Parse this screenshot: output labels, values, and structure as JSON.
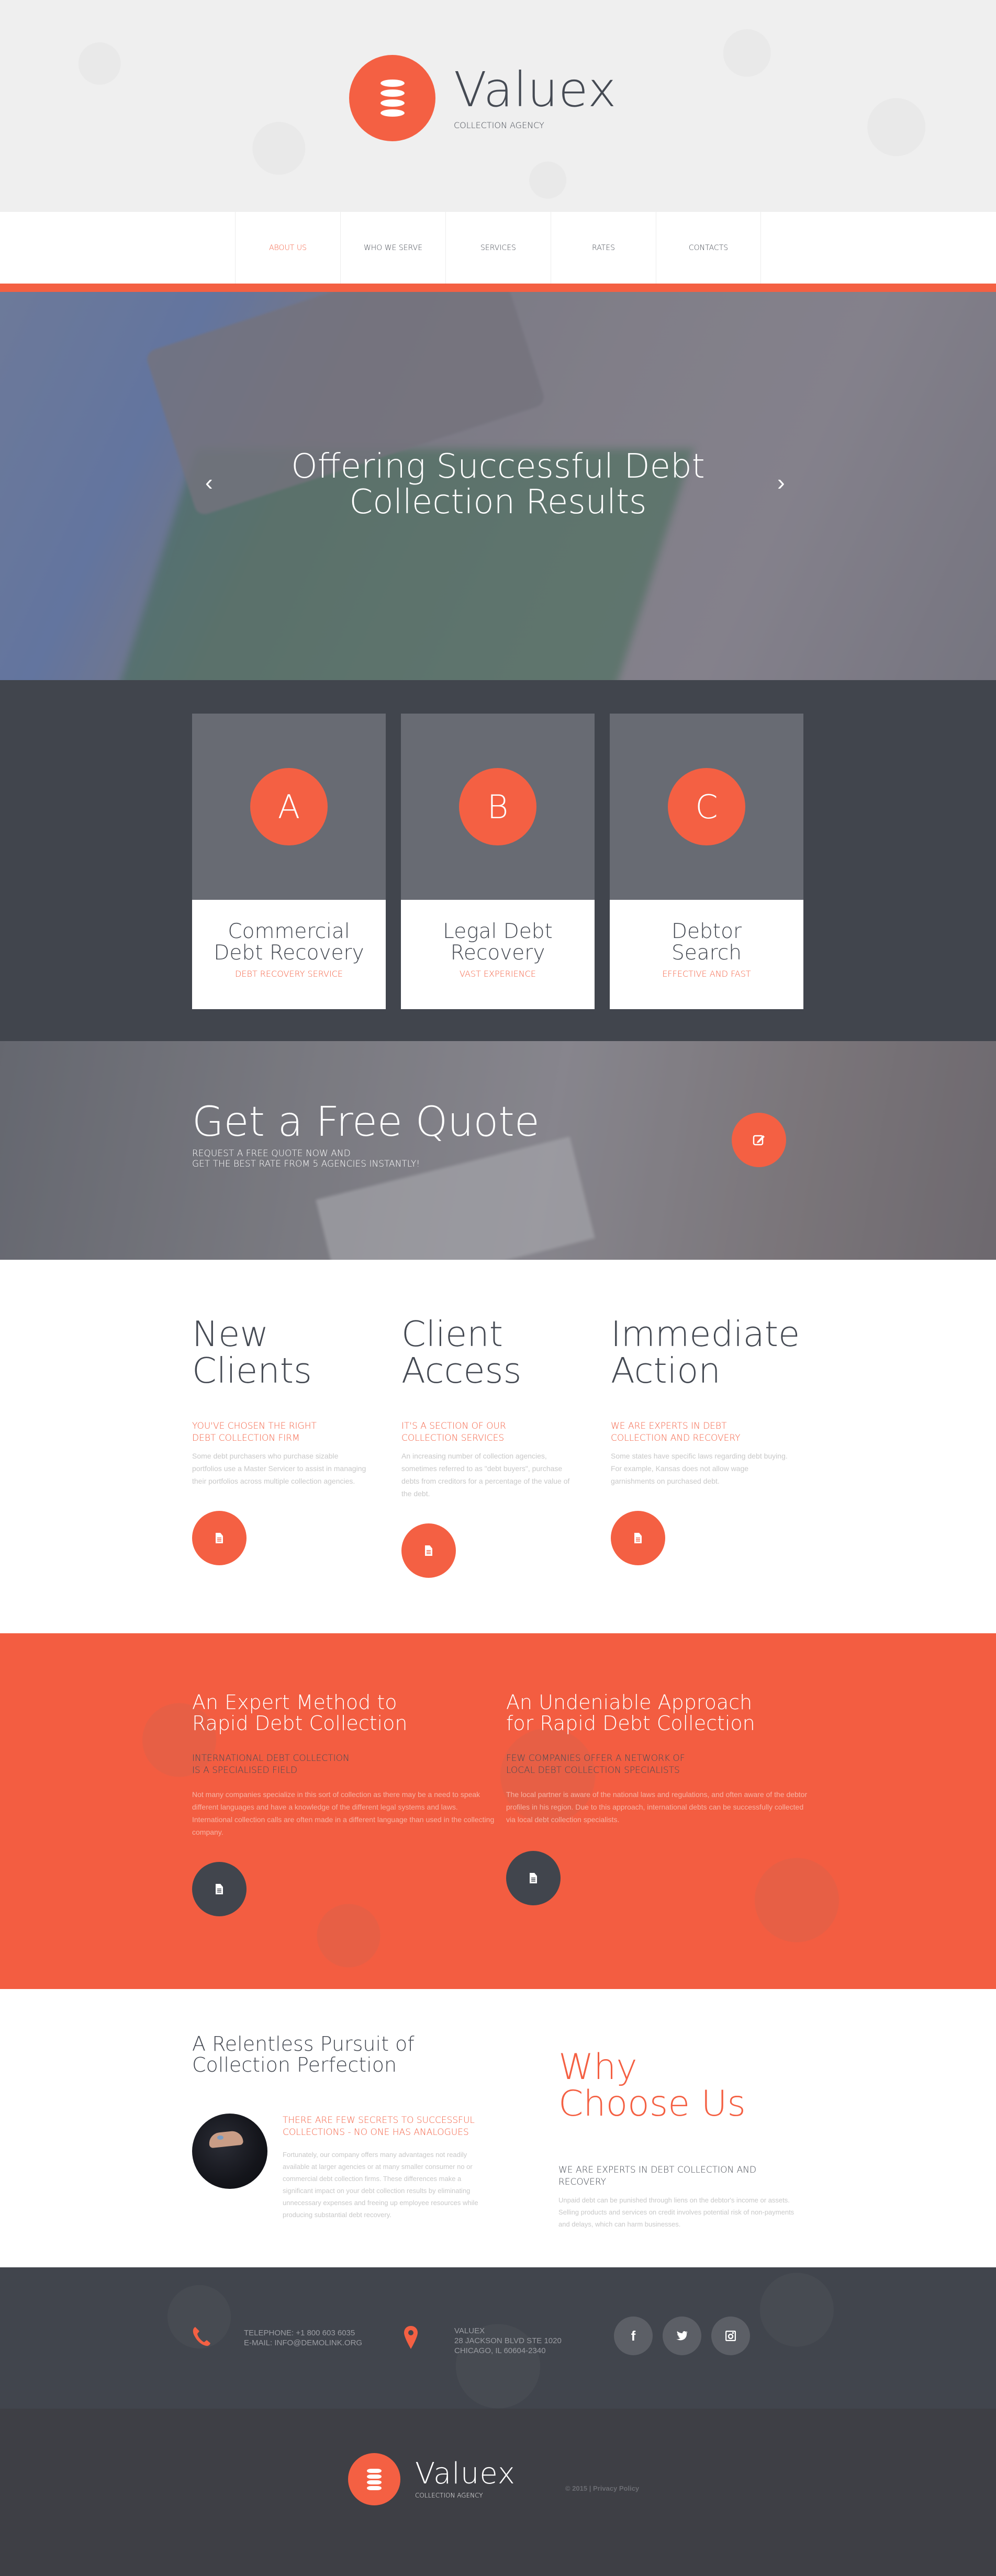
{
  "brand": {
    "name": "Valuex",
    "tagline": "COLLECTION AGENCY",
    "accent": "#f46043",
    "dark": "#41454d"
  },
  "nav": {
    "items": [
      {
        "label": "ABOUT US",
        "active": true
      },
      {
        "label": "WHO WE SERVE"
      },
      {
        "label": "SERVICES"
      },
      {
        "label": "RATES"
      },
      {
        "label": "CONTACTS"
      }
    ]
  },
  "hero": {
    "title_line1": "Offering Successful Debt",
    "title_line2": "Collection Results",
    "prev": "‹",
    "next": "›"
  },
  "services": [
    {
      "letter": "A",
      "title_line1": "Commercial",
      "title_line2": "Debt Recovery",
      "subtitle": "DEBT RECOVERY SERVICE"
    },
    {
      "letter": "B",
      "title_line1": "Legal Debt",
      "title_line2": "Recovery",
      "subtitle": "VAST EXPERIENCE"
    },
    {
      "letter": "C",
      "title_line1": "Debtor",
      "title_line2": "Search",
      "subtitle": "EFFECTIVE AND FAST"
    }
  ],
  "quote": {
    "title": "Get a Free Quote",
    "line1": "REQUEST A FREE QUOTE NOW AND",
    "line2": "GET THE BEST RATE FROM 5 AGENCIES INSTANTLY!"
  },
  "features": [
    {
      "title_line1": "New",
      "title_line2": "Clients",
      "hl_line1": "YOU'VE CHOSEN THE RIGHT",
      "hl_line2": "DEBT COLLECTION FIRM",
      "body": "Some debt purchasers who purchase sizable portfolios use a Master Servicer to assist in managing their portfolios  across multiple collection agencies."
    },
    {
      "title_line1": "Client",
      "title_line2": "Access",
      "hl_line1": "IT'S A SECTION OF OUR",
      "hl_line2": "COLLECTION SERVICES",
      "body": "An increasing number of collection agencies, sometimes referred to as \"debt buyers\", purchase debts from creditors for a percentage of the value of the debt."
    },
    {
      "title_line1": "Immediate",
      "title_line2": "Action",
      "hl_line1": "WE ARE EXPERTS IN DEBT",
      "hl_line2": "COLLECTION AND RECOVERY",
      "body": "Some states have specific laws regarding debt buying. For example, Kansas does not allow wage garnishments on purchased debt."
    }
  ],
  "approaches": [
    {
      "title_line1": "An Expert Method to",
      "title_line2": "Rapid Debt Collection",
      "hl_line1": "INTERNATIONAL DEBT COLLECTION",
      "hl_line2": "IS A SPECIALISED FIELD",
      "body": "Not many companies specialize in this sort of collection as there may be a need to speak different languages and have a knowledge of the different legal systems and laws. International collection calls are often made in a different language than used in the collecting company."
    },
    {
      "title_line1": "An Undeniable Approach",
      "title_line2": "for Rapid Debt Collection",
      "hl_line1": "FEW COMPANIES OFFER A NETWORK OF",
      "hl_line2": "LOCAL DEBT COLLECTION SPECIALISTS",
      "body": "The local partner is aware of the national laws and regulations, and often aware of the debtor profiles in his region. Due to this approach, international debts can be successfully collected via local debt collection specialists."
    }
  ],
  "pursuit": {
    "title_line1": "A Relentless Pursuit of",
    "title_line2": "Collection Perfection",
    "hl_line1": "THERE ARE FEW SECRETS TO SUCCESSFUL",
    "hl_line2": "COLLECTIONS - NO ONE HAS ANALOGUES",
    "body": "Fortunately, our company offers many advantages not readily available at larger agencies or at many smaller consumer no or commercial debt collection firms. These differences make a significant impact on your debt collection results by eliminating unnecessary expenses and freeing up employee resources while producing substantial debt recovery."
  },
  "why": {
    "title_line1": "Why",
    "title_line2": "Choose Us",
    "hl": "WE ARE EXPERTS IN DEBT COLLECTION AND RECOVERY",
    "body": "Unpaid debt can be punished through liens on the debtor's income or assets. Selling products and services on credit involves potential risk of non-payments and delays, which can harm businesses."
  },
  "contact": {
    "phone": "TELEPHONE:  +1 800 603 6035",
    "email": "E-MAIL: INFO@DEMOLINK.ORG",
    "addr1": "VALUEX",
    "addr2": "28 JACKSON BLVD STE 1020",
    "addr3": "CHICAGO, IL 60604-2340",
    "social": [
      {
        "name": "facebook",
        "glyph": "f"
      },
      {
        "name": "twitter",
        "glyph": "t"
      },
      {
        "name": "instagram",
        "glyph": "◙"
      }
    ]
  },
  "footer": {
    "copyright": "© 2015 | ",
    "privacy": "Privacy Policy"
  }
}
